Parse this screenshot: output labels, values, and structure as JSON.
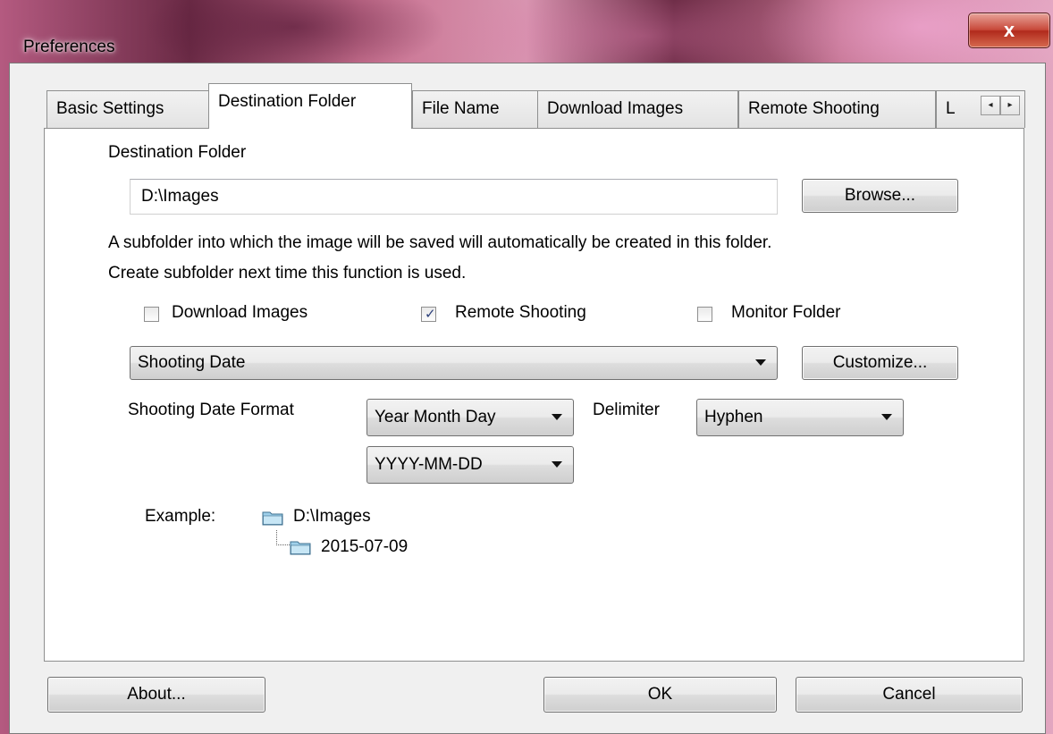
{
  "window": {
    "title": "Preferences",
    "close_glyph": "x"
  },
  "tabs": [
    {
      "label": "Basic Settings"
    },
    {
      "label": "Destination Folder"
    },
    {
      "label": "File Name"
    },
    {
      "label": "Download Images"
    },
    {
      "label": "Remote Shooting"
    },
    {
      "label": "L"
    }
  ],
  "active_tab": "Destination Folder",
  "tab_scroll": {
    "left_icon": "left-arrow-icon",
    "right_icon": "right-arrow-icon",
    "left_glyph": "◂",
    "right_glyph": "▸"
  },
  "destination": {
    "heading": "Destination Folder",
    "path_value": "D:\\Images",
    "browse_label": "Browse...",
    "info_line1": "A subfolder into which the image will be saved will automatically be created in this folder.",
    "info_line2": "Create subfolder next time this function is used."
  },
  "options": {
    "download_images": {
      "label": "Download Images",
      "checked": false
    },
    "remote_shooting": {
      "label": "Remote Shooting",
      "checked": true,
      "mark": "✓"
    },
    "monitor_folder": {
      "label": "Monitor Folder",
      "checked": false
    }
  },
  "subfolder_mode": {
    "selected": "Shooting Date",
    "customize_label": "Customize..."
  },
  "date_format": {
    "label": "Shooting Date Format",
    "order_selected": "Year Month Day",
    "delimiter_label": "Delimiter",
    "delimiter_selected": "Hyphen",
    "pattern_selected": "YYYY-MM-DD"
  },
  "example": {
    "label": "Example:",
    "root": "D:\\Images",
    "subfolder": "2015-07-09"
  },
  "footer": {
    "about_label": "About...",
    "ok_label": "OK",
    "cancel_label": "Cancel"
  },
  "colors": {
    "dialog_bg": "#f0f0f0",
    "panel_bg": "#ffffff",
    "check_color": "#2b3f7a",
    "folder_color": "#9fd0ea"
  }
}
